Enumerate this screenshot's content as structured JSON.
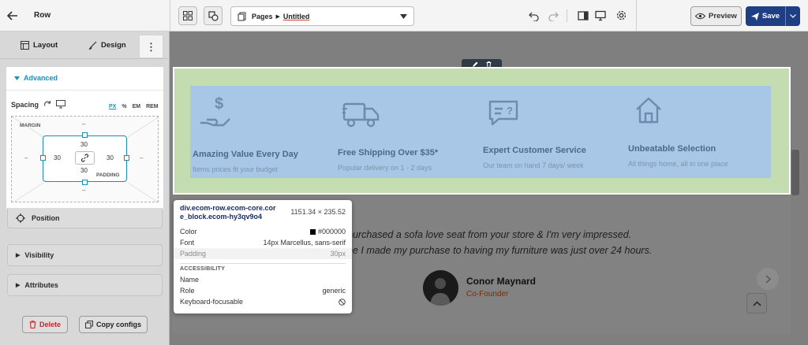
{
  "topbar": {
    "back_title": "Row",
    "pages_label": "Pages",
    "page_name": "Untitled",
    "preview_label": "Preview",
    "save_label": "Save"
  },
  "panel": {
    "tab_layout": "Layout",
    "tab_design": "Design",
    "advanced_label": "Advanced",
    "spacing_label": "Spacing",
    "units": [
      "PX",
      "%",
      "EM",
      "REM"
    ],
    "margin_label": "MARGIN",
    "padding_label": "PADDING",
    "margin_top": "–",
    "margin_bottom": "–",
    "margin_left": "–",
    "margin_right": "–",
    "padding_top": "30",
    "padding_bottom": "30",
    "padding_left": "30",
    "padding_right": "30",
    "position_label": "Position",
    "visibility_label": "Visibility",
    "attributes_label": "Attributes",
    "delete_label": "Delete",
    "copy_label": "Copy configs"
  },
  "features": [
    {
      "icon": "dollar-hand-icon",
      "title": "Amazing Value Every Day",
      "subtitle": "Items prices fit your budget"
    },
    {
      "icon": "truck-icon",
      "title": "Free Shipping Over $35*",
      "subtitle": "Popular delivery on 1 - 2 days"
    },
    {
      "icon": "chat-question-icon",
      "title": "Expert Customer Service",
      "subtitle": "Our team on hand 7 days/ week"
    },
    {
      "icon": "home-icon",
      "title": "Unbeatable Selection",
      "subtitle": "All things home, all in one place"
    }
  ],
  "testimonial": {
    "line1": "purchased a sofa love seat from your store & I'm very impressed.",
    "line2": "he I made my purchase to having my furniture was just over 24 hours.",
    "name": "Conor Maynard",
    "role": "Co-Founder"
  },
  "tooltip": {
    "selector": "div.ecom-row.ecom-core.ecom_block.ecom-hy3qv9o4",
    "selector_line1": "div.ecom-row.ecom-core.cor",
    "selector_line2": "e_block.ecom-hy3qv9o4",
    "dimensions": "1151.34 × 235.52",
    "color_label": "Color",
    "color_value": "#000000",
    "font_label": "Font",
    "font_value": "14px Marcellus, sans-serif",
    "padding_label": "Padding",
    "padding_value": "30px",
    "accessibility_header": "ACCESSIBILITY",
    "name_label": "Name",
    "name_value": "",
    "role_label": "Role",
    "role_value": "generic",
    "focusable_label": "Keyboard-focusable"
  },
  "colors": {
    "accent": "#1a8fb5",
    "save_bg": "#1f3f84",
    "selection_green": "#c4ddb0",
    "highlight_blue": "#a8c7e6",
    "delete_red": "#c62828"
  }
}
